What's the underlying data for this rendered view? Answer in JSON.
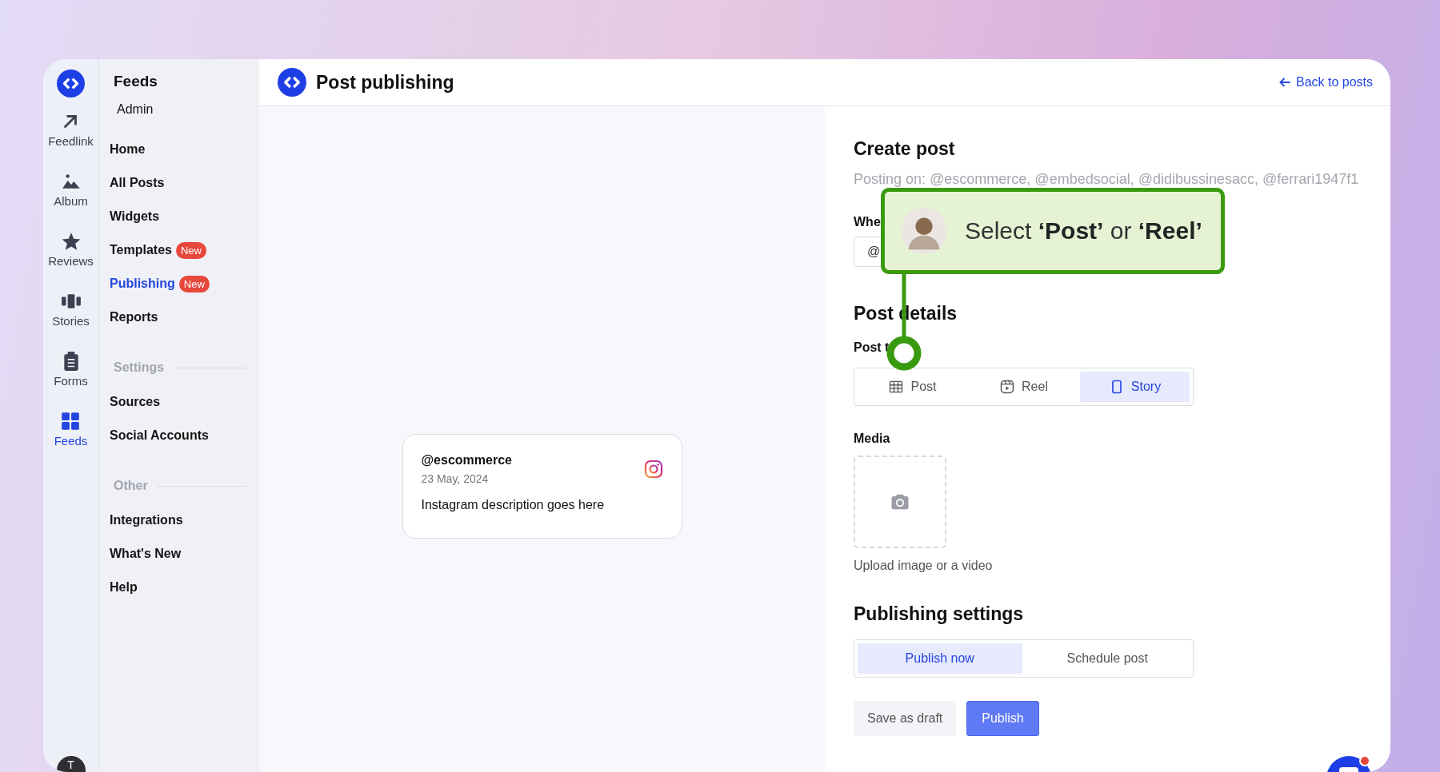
{
  "rail": {
    "items": [
      {
        "kind": "feedlink",
        "label": "Feedlink",
        "selected": false
      },
      {
        "kind": "album",
        "label": "Album",
        "selected": false
      },
      {
        "kind": "reviews",
        "label": "Reviews",
        "selected": false
      },
      {
        "kind": "stories",
        "label": "Stories",
        "selected": false
      },
      {
        "kind": "forms",
        "label": "Forms",
        "selected": false
      },
      {
        "kind": "feeds",
        "label": "Feeds",
        "selected": true
      }
    ],
    "avatar": "T"
  },
  "nav": {
    "title": "Feeds",
    "items": [
      {
        "kind": "account",
        "label": "Admin"
      },
      {
        "kind": "link",
        "label": "Home",
        "selected": false
      },
      {
        "kind": "link",
        "label": "All Posts",
        "selected": false
      },
      {
        "kind": "link",
        "label": "Widgets",
        "selected": false
      },
      {
        "kind": "link",
        "label": "Templates",
        "selected": false,
        "badge": "New"
      },
      {
        "kind": "link",
        "label": "Publishing",
        "selected": true,
        "badge": "New"
      },
      {
        "kind": "link",
        "label": "Reports",
        "selected": false
      },
      {
        "kind": "section",
        "label": "Settings"
      },
      {
        "kind": "link",
        "label": "Sources",
        "selected": false
      },
      {
        "kind": "link",
        "label": "Social Accounts",
        "selected": false
      },
      {
        "kind": "section",
        "label": "Other"
      },
      {
        "kind": "link",
        "label": "Integrations",
        "selected": false
      },
      {
        "kind": "link",
        "label": "What's New",
        "selected": false
      },
      {
        "kind": "link",
        "label": "Help",
        "selected": false
      }
    ]
  },
  "header": {
    "title": "Post publishing",
    "back_link": "Back to posts"
  },
  "preview": {
    "handle": "@escommerce",
    "date": "23 May, 2024",
    "description": "Instagram description goes here"
  },
  "form": {
    "title": "Create post",
    "posting_on": "Posting on: @escommerce, @embedsocial, @didibussinesacc, @ferrari1947f1",
    "when_label": "Whe",
    "when_value": "@",
    "details_title": "Post details",
    "type_label": "Post t",
    "post_types": [
      {
        "kind": "post",
        "label": "Post",
        "selected": false
      },
      {
        "kind": "reel",
        "label": "Reel",
        "selected": false
      },
      {
        "kind": "story",
        "label": "Story",
        "selected": true
      }
    ],
    "media_label": "Media",
    "upload_hint": "Upload image or a video",
    "settings_title": "Publishing settings",
    "publish_modes": [
      {
        "label": "Publish now",
        "selected": true
      },
      {
        "label": "Schedule post",
        "selected": false
      }
    ],
    "buttons": [
      {
        "kind": "secondary",
        "label": "Save as draft"
      },
      {
        "kind": "primary",
        "label": "Publish"
      }
    ]
  },
  "callout": {
    "text": "Select **‘Post’** or **‘Reel’**"
  }
}
